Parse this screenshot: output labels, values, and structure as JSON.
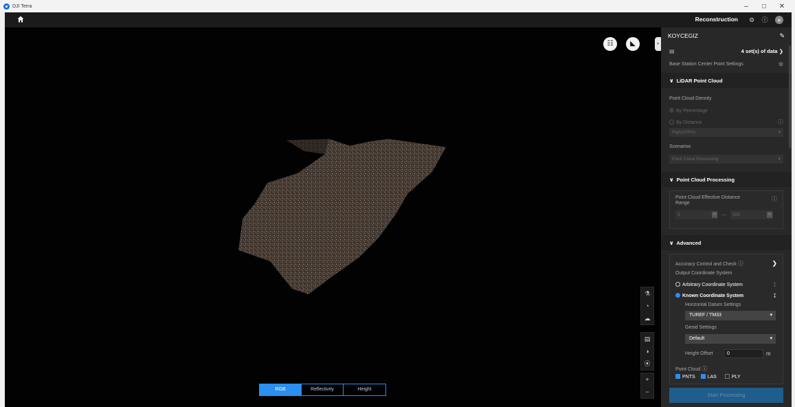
{
  "window": {
    "title": "DJI Terra",
    "controls": [
      "–",
      "□",
      "✕"
    ]
  },
  "header": {
    "mode_label": "Reconstruction"
  },
  "viewport": {
    "top_tools": [
      "☷",
      "◣",
      "»"
    ],
    "side_tools": [
      "⚗",
      "◔",
      "☁",
      "▤",
      "◑",
      "⦿",
      "+",
      "−"
    ],
    "color_modes": [
      "RGB",
      "Reflectivity",
      "Height"
    ],
    "active_color_mode": "RGB"
  },
  "panel": {
    "project_name": "KOYCEGIZ",
    "data_sets": "4 set(s) of data",
    "base_station": "Base Station Center Point Settings",
    "lidar": {
      "title": "LiDAR Point Cloud",
      "density_label": "Point Cloud Density",
      "by_percentage": "By Percentage",
      "by_distance": "By Distance",
      "density_value": "High(100%)",
      "scenarios_label": "Scenarios",
      "scenarios_value": "Point Cloud Processing"
    },
    "processing": {
      "title": "Point Cloud Processing",
      "range_label": "Point Cloud Effective Distance Range",
      "min_value": "3",
      "max_value": "300",
      "unit": "m"
    },
    "advanced": {
      "title": "Advanced",
      "accuracy": "Accuracy Control and Check",
      "output_cs_label": "Output Coordinate System",
      "arbitrary": "Arbitrary Coordinate System",
      "known": "Known Coordinate System",
      "horizontal_label": "Horizontal Datum Settings",
      "horizontal_value": "TUREF / TM33",
      "geoid_label": "Geoid Settings",
      "geoid_value": "Default",
      "height_offset_label": "Height Offset",
      "height_offset_value": "0",
      "height_offset_unit": "m",
      "point_cloud_label": "Point Cloud",
      "formats": [
        "PNTS",
        "LAS",
        "PLY"
      ]
    },
    "start_button": "Start Processing"
  }
}
